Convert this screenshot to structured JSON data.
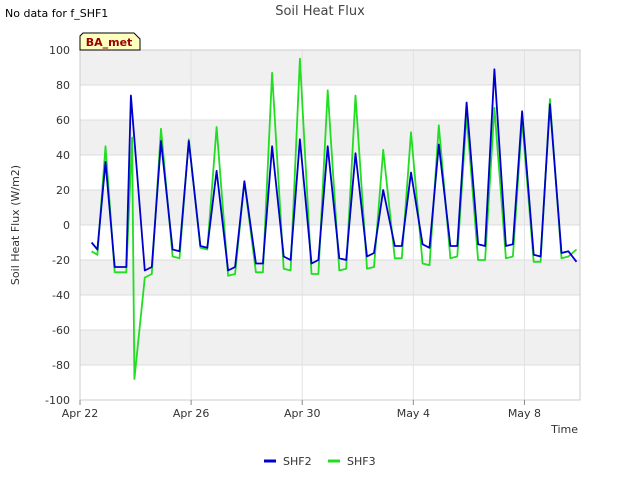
{
  "note": "No data for f_SHF1",
  "badge": "BA_met",
  "colors": {
    "SHF2": "#0000cc",
    "SHF3": "#22dd22",
    "band": "#f0f0f0",
    "badge_bg": "#ffffc0",
    "badge_text": "#990000"
  },
  "chart_data": {
    "type": "line",
    "title": "Soil Heat Flux",
    "xlabel": "Time",
    "ylabel": "Soil Heat Flux (W/m2)",
    "ylim": [
      -100,
      100
    ],
    "yticks": [
      -100,
      -80,
      -60,
      -40,
      -20,
      0,
      20,
      40,
      60,
      80,
      100
    ],
    "xlim": [
      "2024-04-22",
      "2024-05-10"
    ],
    "xticks": [
      {
        "date": "2024-04-22",
        "label": "Apr 22"
      },
      {
        "date": "2024-04-26",
        "label": "Apr 26"
      },
      {
        "date": "2024-04-30",
        "label": "Apr 30"
      },
      {
        "date": "2024-05-04",
        "label": "May 4"
      },
      {
        "date": "2024-05-08",
        "label": "May 8"
      }
    ],
    "grid": true,
    "legend": "bottom-center",
    "series": [
      {
        "name": "SHF2",
        "x": [
          "2024-04-22 10:00",
          "2024-04-22 15:00",
          "2024-04-22 22:00",
          "2024-04-23 06:00",
          "2024-04-23 16:00",
          "2024-04-23 20:00",
          "2024-04-24 08:00",
          "2024-04-24 14:00",
          "2024-04-24 22:00",
          "2024-04-25 08:00",
          "2024-04-25 14:00",
          "2024-04-25 22:00",
          "2024-04-26 08:00",
          "2024-04-26 14:00",
          "2024-04-26 22:00",
          "2024-04-27 08:00",
          "2024-04-27 14:00",
          "2024-04-27 22:00",
          "2024-04-28 08:00",
          "2024-04-28 14:00",
          "2024-04-28 22:00",
          "2024-04-29 08:00",
          "2024-04-29 14:00",
          "2024-04-29 22:00",
          "2024-04-30 08:00",
          "2024-04-30 14:00",
          "2024-04-30 22:00",
          "2024-05-01 08:00",
          "2024-05-01 14:00",
          "2024-05-01 22:00",
          "2024-05-02 08:00",
          "2024-05-02 14:00",
          "2024-05-02 22:00",
          "2024-05-03 08:00",
          "2024-05-03 14:00",
          "2024-05-03 22:00",
          "2024-05-04 08:00",
          "2024-05-04 14:00",
          "2024-05-04 22:00",
          "2024-05-05 08:00",
          "2024-05-05 14:00",
          "2024-05-05 22:00",
          "2024-05-06 08:00",
          "2024-05-06 14:00",
          "2024-05-06 22:00",
          "2024-05-07 08:00",
          "2024-05-07 14:00",
          "2024-05-07 22:00",
          "2024-05-08 08:00",
          "2024-05-08 14:00",
          "2024-05-08 22:00",
          "2024-05-09 08:00",
          "2024-05-09 14:00",
          "2024-05-09 21:00"
        ],
        "y": [
          -10,
          -14,
          36,
          -24,
          -24,
          74,
          -26,
          -24,
          48,
          -14,
          -15,
          48,
          -12,
          -13,
          31,
          -26,
          -24,
          25,
          -22,
          -22,
          45,
          -18,
          -20,
          49,
          -22,
          -20,
          45,
          -19,
          -20,
          41,
          -18,
          -16,
          20,
          -12,
          -12,
          30,
          -11,
          -13,
          46,
          -12,
          -12,
          70,
          -11,
          -12,
          89,
          -12,
          -11,
          65,
          -17,
          -18,
          69,
          -16,
          -15,
          -21
        ]
      },
      {
        "name": "SHF3",
        "x": [
          "2024-04-22 10:00",
          "2024-04-22 15:00",
          "2024-04-22 22:00",
          "2024-04-23 06:00",
          "2024-04-23 16:00",
          "2024-04-23 21:00",
          "2024-04-23 23:00",
          "2024-04-24 08:00",
          "2024-04-24 14:00",
          "2024-04-24 22:00",
          "2024-04-25 08:00",
          "2024-04-25 14:00",
          "2024-04-25 22:00",
          "2024-04-26 08:00",
          "2024-04-26 14:00",
          "2024-04-26 22:00",
          "2024-04-27 08:00",
          "2024-04-27 14:00",
          "2024-04-27 22:00",
          "2024-04-28 08:00",
          "2024-04-28 14:00",
          "2024-04-28 22:00",
          "2024-04-29 08:00",
          "2024-04-29 14:00",
          "2024-04-29 22:00",
          "2024-04-30 08:00",
          "2024-04-30 14:00",
          "2024-04-30 22:00",
          "2024-05-01 08:00",
          "2024-05-01 14:00",
          "2024-05-01 22:00",
          "2024-05-02 08:00",
          "2024-05-02 14:00",
          "2024-05-02 22:00",
          "2024-05-03 08:00",
          "2024-05-03 14:00",
          "2024-05-03 22:00",
          "2024-05-04 08:00",
          "2024-05-04 14:00",
          "2024-05-04 22:00",
          "2024-05-05 08:00",
          "2024-05-05 14:00",
          "2024-05-05 22:00",
          "2024-05-06 08:00",
          "2024-05-06 14:00",
          "2024-05-06 22:00",
          "2024-05-07 08:00",
          "2024-05-07 14:00",
          "2024-05-07 22:00",
          "2024-05-08 08:00",
          "2024-05-08 14:00",
          "2024-05-08 22:00",
          "2024-05-09 08:00",
          "2024-05-09 14:00",
          "2024-05-09 21:00"
        ],
        "y": [
          -15,
          -17,
          45,
          -27,
          -27,
          50,
          -88,
          -30,
          -28,
          55,
          -18,
          -19,
          49,
          -13,
          -14,
          56,
          -29,
          -28,
          25,
          -27,
          -27,
          87,
          -25,
          -26,
          95,
          -28,
          -28,
          77,
          -26,
          -25,
          74,
          -25,
          -24,
          43,
          -19,
          -19,
          53,
          -22,
          -23,
          57,
          -19,
          -18,
          63,
          -20,
          -20,
          67,
          -19,
          -18,
          60,
          -21,
          -21,
          72,
          -19,
          -18,
          -14
        ]
      }
    ]
  }
}
